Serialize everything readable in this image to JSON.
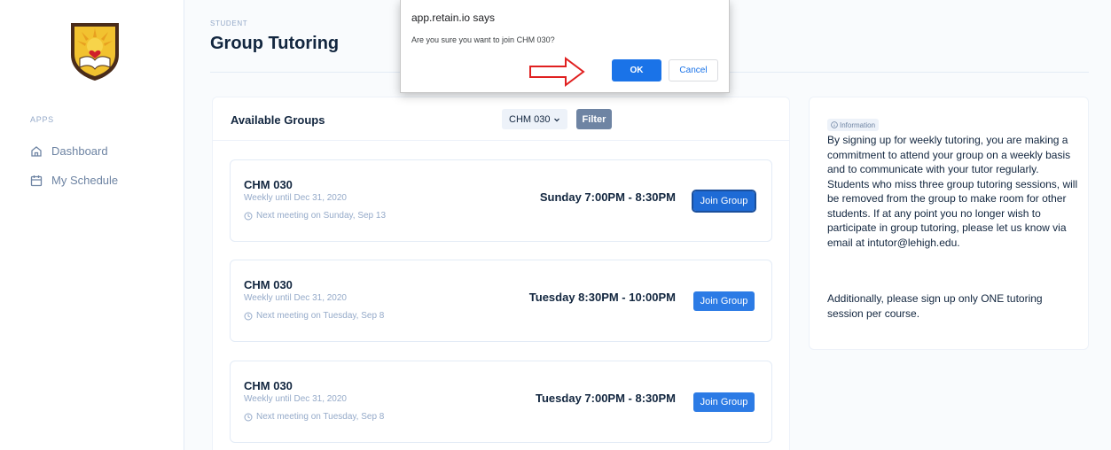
{
  "sidebar": {
    "apps_label": "APPS",
    "items": [
      {
        "label": "Dashboard",
        "icon": "home-icon"
      },
      {
        "label": "My Schedule",
        "icon": "calendar-icon"
      }
    ]
  },
  "header": {
    "eyebrow": "STUDENT",
    "title": "Group Tutoring"
  },
  "groups": {
    "title": "Available Groups",
    "course_select": "CHM 030",
    "filter_label": "Filter",
    "items": [
      {
        "name": "CHM 030",
        "recurrence": "Weekly until Dec 31, 2020",
        "next": "Next meeting on Sunday, Sep 13",
        "time": "Sunday 7:00PM - 8:30PM",
        "button": "Join Group"
      },
      {
        "name": "CHM 030",
        "recurrence": "Weekly until Dec 31, 2020",
        "next": "Next meeting on Tuesday, Sep 8",
        "time": "Tuesday 8:30PM - 10:00PM",
        "button": "Join Group"
      },
      {
        "name": "CHM 030",
        "recurrence": "Weekly until Dec 31, 2020",
        "next": "Next meeting on Tuesday, Sep 8",
        "time": "Tuesday 7:00PM - 8:30PM",
        "button": "Join Group"
      }
    ]
  },
  "info": {
    "badge": "Information",
    "paragraph1": "By signing up for weekly tutoring, you are making a commitment to attend your group on a weekly basis and to communicate with your tutor regularly. Students who miss three group tutoring sessions, will be removed from the group to make room for other students. If at any point you no longer wish to participate in group tutoring, please let us know via email at intutor@lehigh.edu.",
    "paragraph2": "Additionally, please sign up only ONE tutoring session per course."
  },
  "dialog": {
    "title": "app.retain.io says",
    "message": "Are you sure you want to join CHM 030?",
    "ok": "OK",
    "cancel": "Cancel"
  },
  "colors": {
    "primary": "#2c7be5",
    "dialog_primary": "#1a73e8",
    "annotation_arrow": "#e02020"
  }
}
